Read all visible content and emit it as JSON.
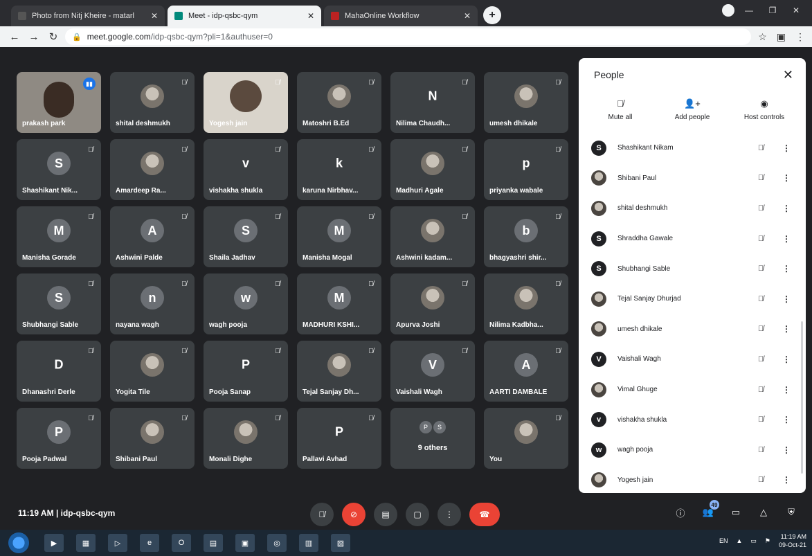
{
  "browser": {
    "tabs": [
      {
        "title": "Photo from Nitj Kheire - matarl",
        "active": false
      },
      {
        "title": "Meet - idp-qsbc-qym",
        "active": true
      },
      {
        "title": "MahaOnline Workflow",
        "active": false
      }
    ],
    "new_tab": "+",
    "url_host": "meet.google.com",
    "url_path": "/idp-qsbc-qym?pli=1&authuser=0"
  },
  "tiles": [
    {
      "name": "prakash park",
      "kind": "video",
      "speaking": true
    },
    {
      "name": "shital deshmukh",
      "kind": "photo"
    },
    {
      "name": "Yogesh jain",
      "kind": "video2"
    },
    {
      "name": "Matoshri B.Ed",
      "kind": "photo"
    },
    {
      "name": "Nilima Chaudh...",
      "kind": "plain",
      "initial": "N"
    },
    {
      "name": "umesh dhikale",
      "kind": "photo"
    },
    {
      "name": "Shashikant Nik...",
      "kind": "initial",
      "initial": "S"
    },
    {
      "name": "Amardeep Ra...",
      "kind": "photo"
    },
    {
      "name": "vishakha shukla",
      "kind": "plain",
      "initial": "v"
    },
    {
      "name": "karuna Nirbhav...",
      "kind": "plain",
      "initial": "k"
    },
    {
      "name": "Madhuri Agale",
      "kind": "photo"
    },
    {
      "name": "priyanka wabale",
      "kind": "plain",
      "initial": "p"
    },
    {
      "name": "Manisha Gorade",
      "kind": "initial",
      "initial": "M"
    },
    {
      "name": "Ashwini Palde",
      "kind": "initial",
      "initial": "A"
    },
    {
      "name": "Shaila Jadhav",
      "kind": "initial",
      "initial": "S"
    },
    {
      "name": "Manisha Mogal",
      "kind": "initial",
      "initial": "M"
    },
    {
      "name": "Ashwini kadam...",
      "kind": "photo"
    },
    {
      "name": "bhagyashri shir...",
      "kind": "initial",
      "initial": "b"
    },
    {
      "name": "Shubhangi Sable",
      "kind": "initial",
      "initial": "S"
    },
    {
      "name": "nayana wagh",
      "kind": "initial",
      "initial": "n"
    },
    {
      "name": "wagh pooja",
      "kind": "initial",
      "initial": "w"
    },
    {
      "name": "MADHURI KSHI...",
      "kind": "initial",
      "initial": "M"
    },
    {
      "name": "Apurva Joshi",
      "kind": "photo"
    },
    {
      "name": "Nilima Kadbha...",
      "kind": "photo"
    },
    {
      "name": "Dhanashri Derle",
      "kind": "plain",
      "initial": "D"
    },
    {
      "name": "Yogita Tile",
      "kind": "photo"
    },
    {
      "name": "Pooja Sanap",
      "kind": "plain",
      "initial": "P"
    },
    {
      "name": "Tejal Sanjay Dh...",
      "kind": "photo"
    },
    {
      "name": "Vaishali Wagh",
      "kind": "initial",
      "initial": "V"
    },
    {
      "name": "AARTI DAMBALE",
      "kind": "initial",
      "initial": "A"
    },
    {
      "name": "Pooja Padwal",
      "kind": "initial",
      "initial": "P"
    },
    {
      "name": "Shibani Paul",
      "kind": "photo"
    },
    {
      "name": "Monali Dighe",
      "kind": "photo"
    },
    {
      "name": "Pallavi Avhad",
      "kind": "plain",
      "initial": "P"
    },
    {
      "name": "",
      "kind": "others",
      "label": "9 others",
      "avatars": [
        "P",
        "S"
      ]
    },
    {
      "name": "You",
      "kind": "photo"
    }
  ],
  "people_panel": {
    "title": "People",
    "actions": [
      {
        "label": "Mute all",
        "icon": "mic-off-icon",
        "glyph": "🎙"
      },
      {
        "label": "Add people",
        "icon": "add-person-icon",
        "glyph": "👤+"
      },
      {
        "label": "Host controls",
        "icon": "toggle-icon",
        "glyph": "◉"
      }
    ],
    "participants": [
      {
        "name": "Shashikant Nikam",
        "avatar": "S",
        "photo": false
      },
      {
        "name": "Shibani Paul",
        "avatar": "",
        "photo": true
      },
      {
        "name": "shital deshmukh",
        "avatar": "",
        "photo": true
      },
      {
        "name": "Shraddha Gawale",
        "avatar": "S",
        "photo": false
      },
      {
        "name": "Shubhangi Sable",
        "avatar": "S",
        "photo": false
      },
      {
        "name": "Tejal Sanjay Dhurjad",
        "avatar": "",
        "photo": true
      },
      {
        "name": "umesh dhikale",
        "avatar": "",
        "photo": true
      },
      {
        "name": "Vaishali Wagh",
        "avatar": "V",
        "photo": false
      },
      {
        "name": "Vimal Ghuge",
        "avatar": "",
        "photo": true
      },
      {
        "name": "vishakha shukla",
        "avatar": "v",
        "photo": false
      },
      {
        "name": "wagh pooja",
        "avatar": "w",
        "photo": false
      },
      {
        "name": "Yogesh jain",
        "avatar": "",
        "photo": true
      }
    ]
  },
  "meeting": {
    "time": "11:19 AM",
    "separator": "|",
    "code": "idp-qsbc-qym",
    "people_count": "49"
  },
  "taskbar": {
    "lang": "EN",
    "time": "11:19 AM",
    "date": "09-Oct-21"
  }
}
